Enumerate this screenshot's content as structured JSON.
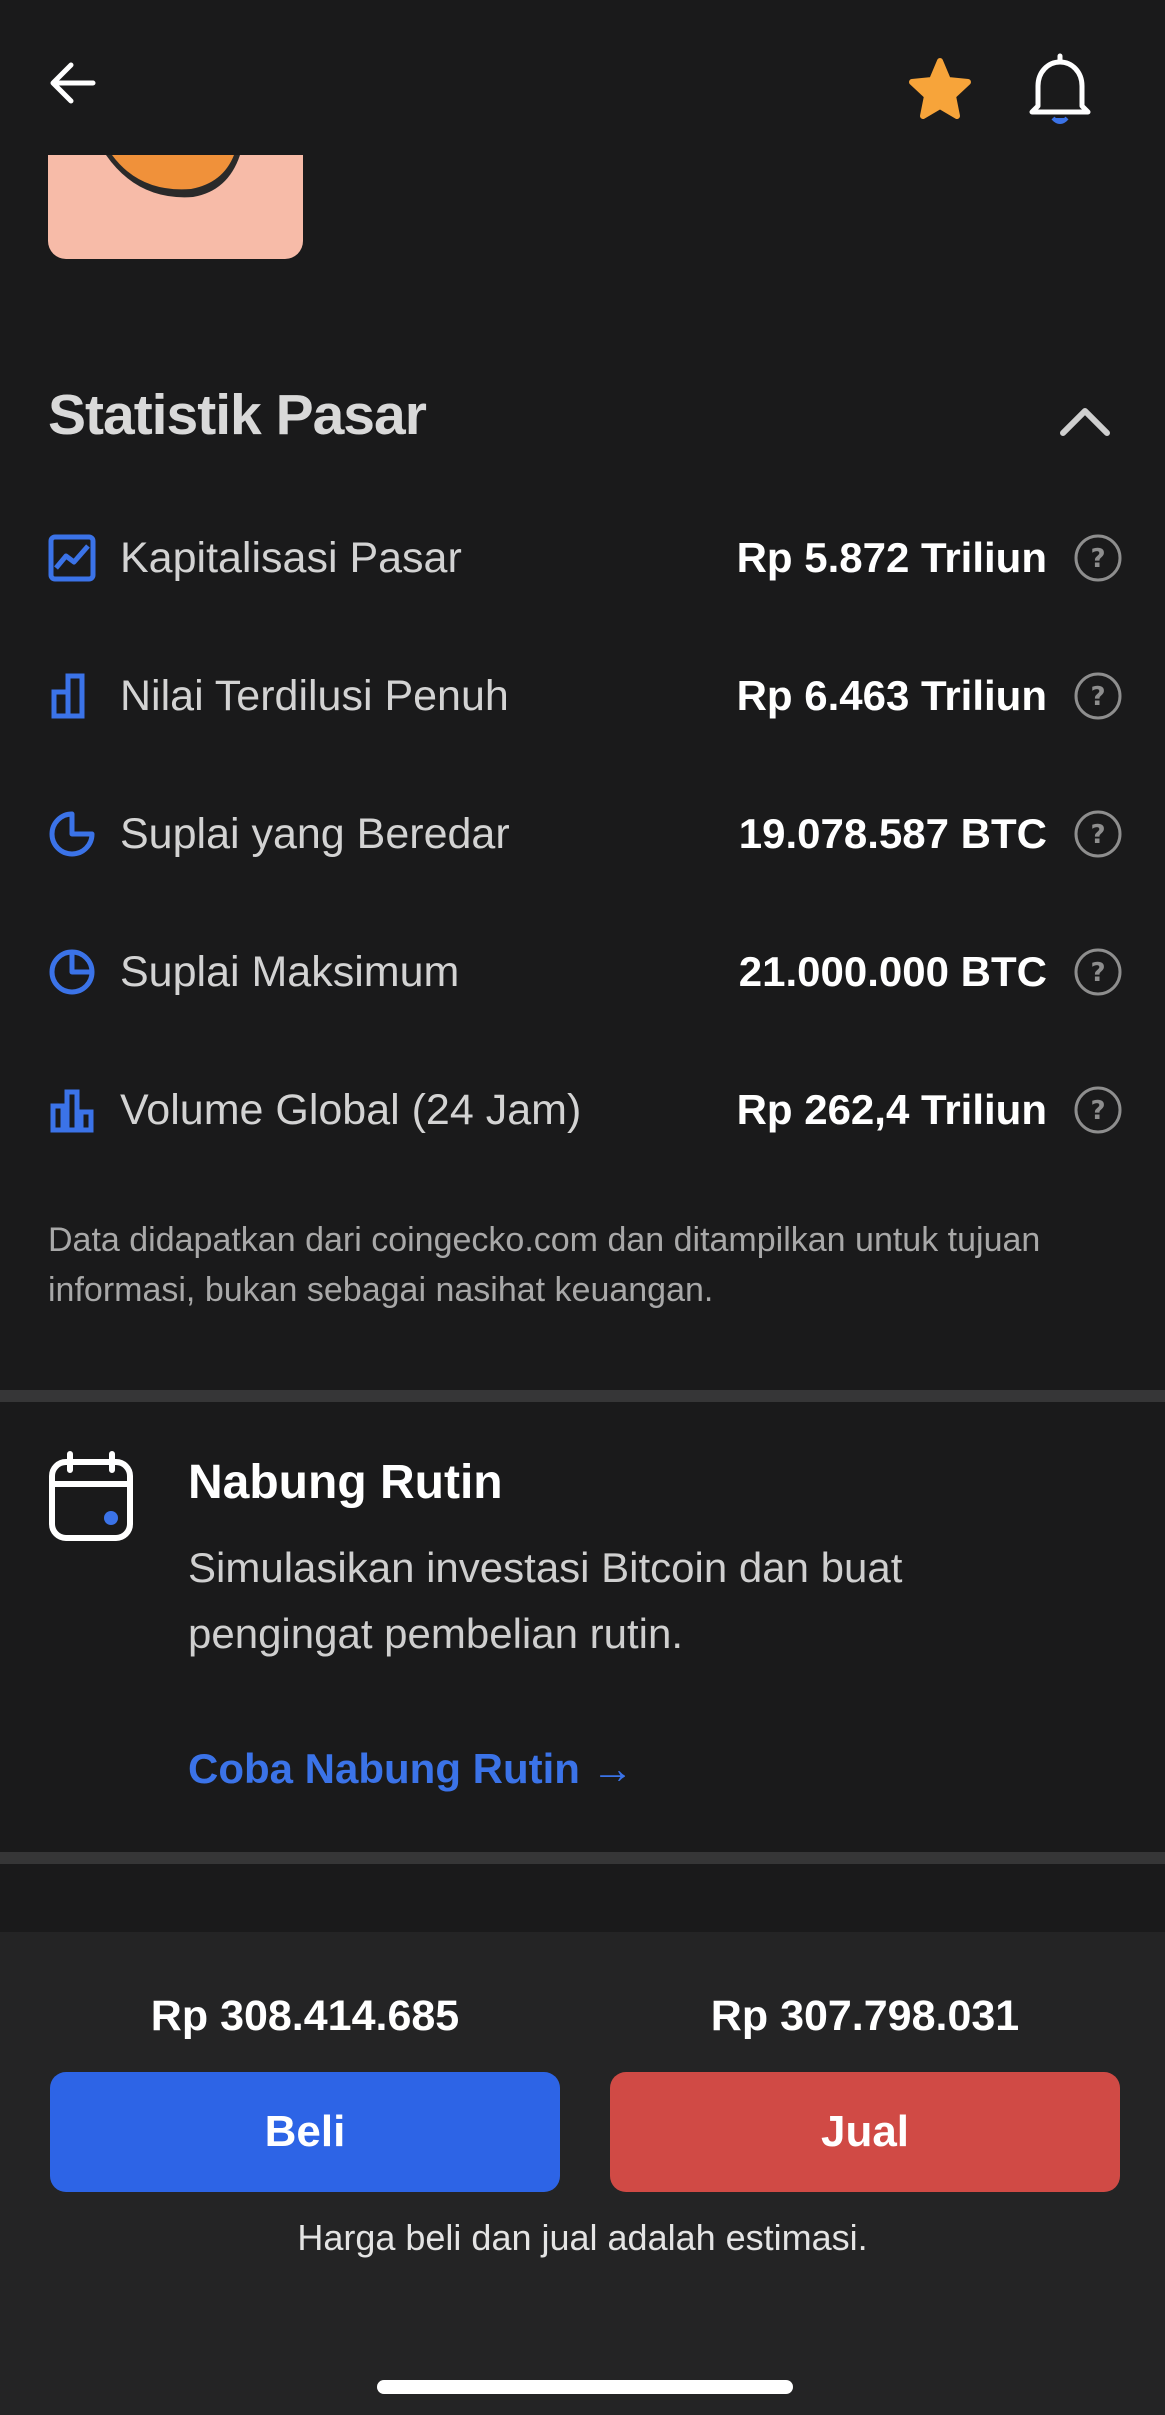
{
  "header": {
    "back_icon": "arrow-left-icon",
    "favorite_icon": "star-icon",
    "notification_icon": "bell-icon",
    "favorite_color": "#f7a43a"
  },
  "market_stats": {
    "title": "Statistik Pasar",
    "collapse_icon": "chevron-up-icon",
    "rows": [
      {
        "icon": "line-chart-icon",
        "label": "Kapitalisasi Pasar",
        "value": "Rp 5.872 Triliun"
      },
      {
        "icon": "bar-chart-icon",
        "label": "Nilai Terdilusi Penuh",
        "value": "Rp 6.463 Triliun"
      },
      {
        "icon": "pie-chart-icon",
        "label": "Suplai yang Beredar",
        "value": "19.078.587 BTC"
      },
      {
        "icon": "clock-pie-icon",
        "label": "Suplai Maksimum",
        "value": "21.000.000 BTC"
      },
      {
        "icon": "volume-bars-icon",
        "label": "Volume Global (24 Jam)",
        "value": "Rp 262,4 Triliun"
      }
    ],
    "disclaimer": "Data didapatkan dari coingecko.com dan ditampilkan untuk tujuan informasi, bukan sebagai nasihat keuangan."
  },
  "nabung": {
    "title": "Nabung Rutin",
    "description": "Simulasikan investasi Bitcoin dan buat pengingat pembelian rutin.",
    "link_label": "Coba Nabung Rutin →",
    "accent_color": "#3b73e8"
  },
  "trade": {
    "buy_price": "Rp 308.414.685",
    "sell_price": "Rp 307.798.031",
    "buy_label": "Beli",
    "sell_label": "Jual",
    "note": "Harga beli dan jual adalah estimasi.",
    "buy_color": "#2d64e6",
    "sell_color": "#d04a45"
  }
}
